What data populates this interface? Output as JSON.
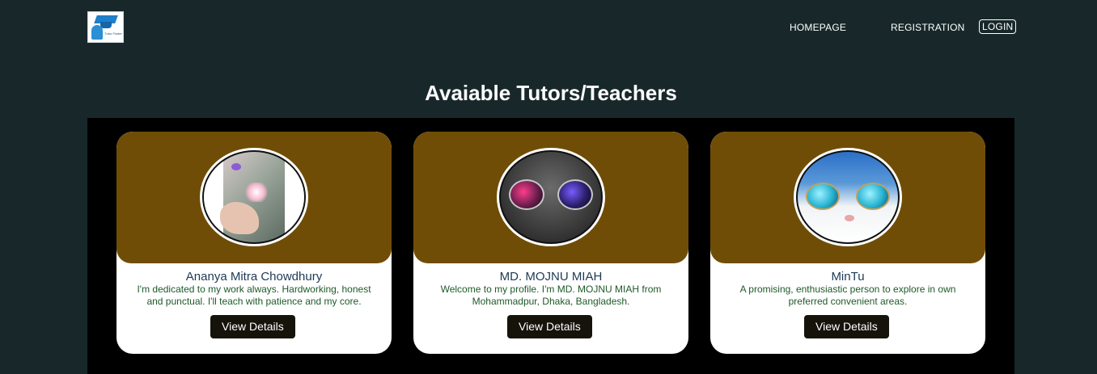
{
  "logo": {
    "text": "Tutor Finder"
  },
  "nav": {
    "home": "HOMEPAGE",
    "registration": "REGISTRATION",
    "login": "LOGIN"
  },
  "page": {
    "heading": "Avaiable Tutors/Teachers"
  },
  "colors": {
    "background": "#18282a",
    "panel": "#000000",
    "banner": "#704d06",
    "button": "#16130b",
    "description": "#1e5a28",
    "name": "#1d3a55"
  },
  "tutors": [
    {
      "name": "Ananya Mitra Chowdhury",
      "description": "I'm dedicated to my work always. Hardworking, honest and punctual. I'll teach with patience and my core.",
      "button": "View Details",
      "avatar": "blossom-hand-photo"
    },
    {
      "name": "MD. MOJNU MIAH",
      "description": "Welcome to my profile. I'm MD. MOJNU MIAH from Mohammadpur, Dhaka, Bangladesh.",
      "button": "View Details",
      "avatar": "cat-with-galaxy-glasses-photo"
    },
    {
      "name": "MinTu",
      "description": "A promising, enthusiastic person to explore in own preferred convenient areas.",
      "button": "View Details",
      "avatar": "cat-with-blue-glasses-photo"
    }
  ]
}
